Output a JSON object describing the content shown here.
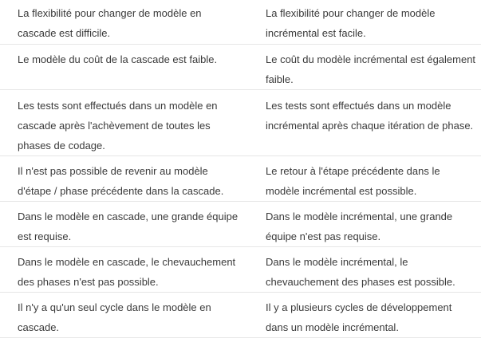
{
  "rows": [
    {
      "left": "La flexibilité pour changer de modèle en cascade est difficile.",
      "right": "La flexibilité pour changer de modèle incrémental est facile."
    },
    {
      "left": "Le modèle du coût de la cascade est faible.",
      "right": "Le coût du modèle incrémental est également faible."
    },
    {
      "left": "Les tests sont effectués dans un modèle en cascade après l'achèvement de toutes les phases de codage.",
      "right": "Les tests sont effectués dans un modèle incrémental après chaque itération de phase."
    },
    {
      "left": "Il n'est pas possible de revenir au modèle d'étape / phase précédente dans la cascade.",
      "right": "Le retour à l'étape précédente dans le modèle incrémental est possible."
    },
    {
      "left": "Dans le modèle en cascade, une grande équipe est requise.",
      "right": "Dans le modèle incrémental, une grande équipe n'est pas requise."
    },
    {
      "left": "Dans le modèle en cascade, le chevauchement des phases n'est pas possible.",
      "right": "Dans le modèle incrémental, le chevauchement des phases est possible."
    },
    {
      "left": "Il n'y a qu'un seul cycle dans le modèle en cascade.",
      "right": "Il y a plusieurs cycles de développement dans un modèle incrémental."
    }
  ]
}
